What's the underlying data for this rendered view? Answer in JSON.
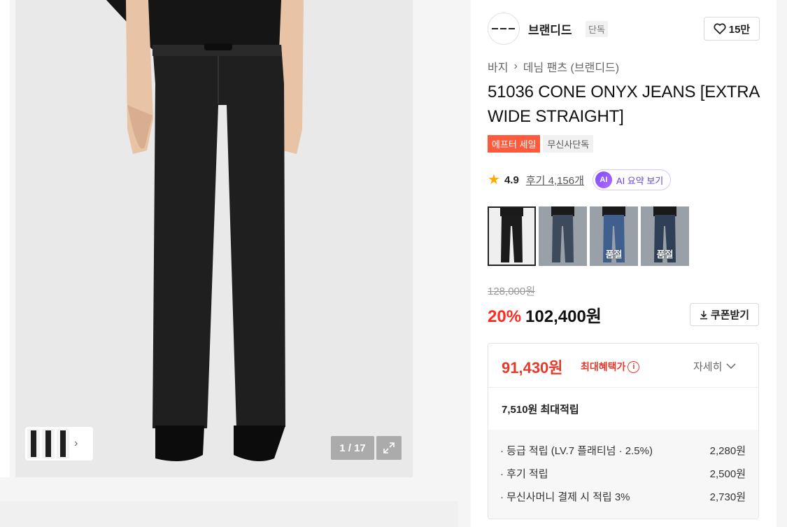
{
  "gallery": {
    "counter": "1 / 17",
    "icons": {
      "expand": "expand-icon",
      "next": "chevron-right-icon"
    }
  },
  "brand": {
    "name": "브랜디드",
    "badge": "단독",
    "likes": "15만",
    "icons": {
      "logo": "brand-logo-icon",
      "heart": "heart-icon"
    }
  },
  "breadcrumb": [
    "바지",
    "데님 팬츠 (브랜디드)"
  ],
  "product": {
    "title": "51036 CONE ONYX JEANS [EXTRA WIDE STRAIGHT]",
    "badges": [
      "에프터 세일",
      "무신사단독"
    ]
  },
  "rating": {
    "value": "4.9",
    "reviews": "후기 4,156개",
    "ai_label": "AI 요약 보기",
    "ai_mark": "AI"
  },
  "variants": [
    {
      "label": "",
      "color": "#1c1c1c",
      "selected": true
    },
    {
      "label": "",
      "color": "#3d4a5c",
      "selected": false
    },
    {
      "label": "품절",
      "color": "#3f5f8e",
      "selected": false
    },
    {
      "label": "품절",
      "color": "#2e3f57",
      "selected": false
    }
  ],
  "price": {
    "original": "128,000원",
    "discount": "20%",
    "sale": "102,400원",
    "coupon_label": "쿠폰받기"
  },
  "benefit": {
    "max_price": "91,430원",
    "max_label": "최대혜택가",
    "detail_label": "자세히",
    "points_summary": "7,510원 최대적립",
    "points": [
      {
        "label": "· 등급 적립 (LV.7 플래티넘 · 2.5%)",
        "amount": "2,280원"
      },
      {
        "label": "· 후기 적립",
        "amount": "2,500원"
      },
      {
        "label": "· 무신사머니 결제 시 적립 3%",
        "amount": "2,730원"
      }
    ]
  },
  "colors": {
    "accent_red": "#ff2b1f",
    "benefit_red": "#e53a2a",
    "sale_badge": "#ff5a3c",
    "ai_purple": "#6a3cf0"
  }
}
